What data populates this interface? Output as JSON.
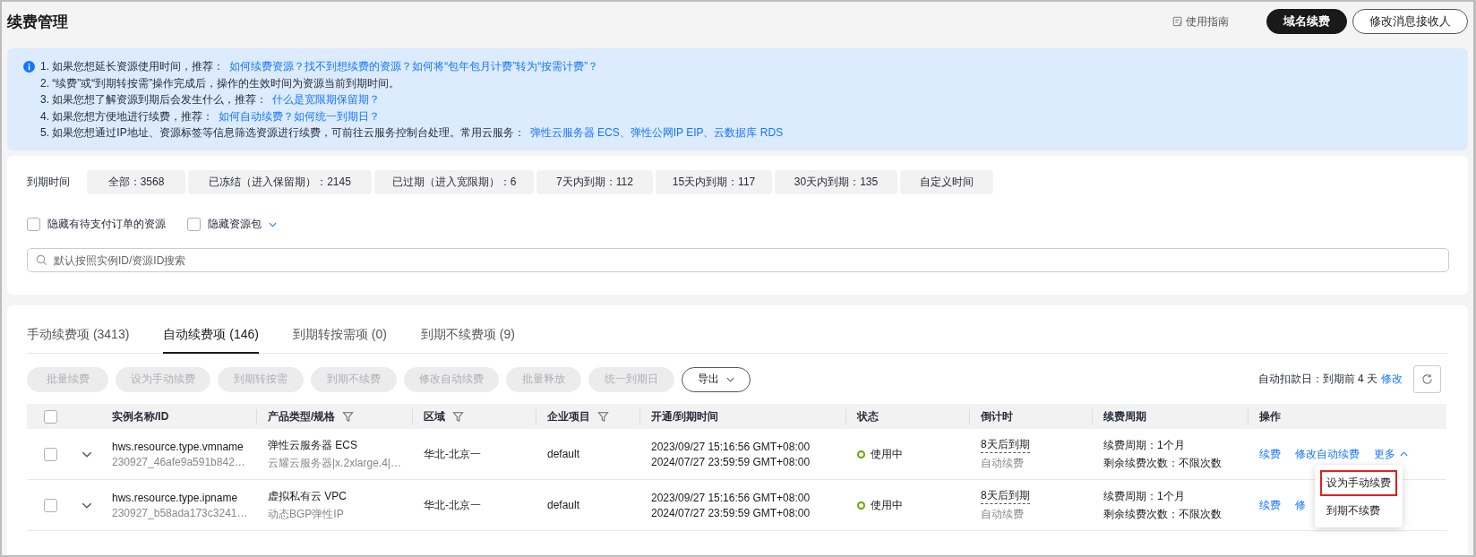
{
  "page_title": "续费管理",
  "header_actions": {
    "guide_link": "使用指南",
    "buttons": [
      {
        "label": "域名续费",
        "kind": "primary"
      },
      {
        "label": "修改消息接收人",
        "kind": "outline"
      }
    ]
  },
  "notice": {
    "lines": [
      {
        "text": "1. 如果您想延长资源使用时间，推荐：",
        "links": [
          "如何续费资源？找不到想续费的资源？如何将“包年包月计费”转为“按需计费”？"
        ]
      },
      {
        "text": "2. “续费”或“到期转按需”操作完成后，操作的生效时间为资源当前到期时间。"
      },
      {
        "text": "3. 如果您想了解资源到期后会发生什么，推荐：",
        "links": [
          "什么是宽限期保留期？"
        ]
      },
      {
        "text": "4. 如果您想方便地进行续费，推荐：",
        "links": [
          "如何自动续费？如何统一到期日？"
        ]
      },
      {
        "text": "5. 如果您想通过IP地址、资源标签等信息筛选资源进行续费，可前往云服务控制台处理。常用云服务：",
        "links": [
          "弹性云服务器 ECS、弹性公网IP EIP、云数据库 RDS"
        ]
      }
    ]
  },
  "filters": {
    "label": "到期时间",
    "chips": [
      "全部：3568",
      "已冻结（进入保留期）：2145",
      "已过期（进入宽限期）：6",
      "7天内到期：112",
      "15天内到期：117",
      "30天内到期：135",
      "自定义时间"
    ],
    "checkboxes": [
      {
        "label": "隐藏有待支付订单的资源",
        "checked": false,
        "kind": "plain"
      },
      {
        "label": "隐藏资源包",
        "checked": false,
        "kind": "dropdown"
      }
    ],
    "search": {
      "placeholder": "默认按照实例ID/资源ID搜索"
    }
  },
  "tabs": [
    {
      "label": "手动续费项 (3413)",
      "selected": false
    },
    {
      "label": "自动续费项 (146)",
      "selected": true
    },
    {
      "label": "到期转按需项 (0)",
      "selected": false
    },
    {
      "label": "到期不续费项 (9)",
      "selected": false
    }
  ],
  "toolbar": {
    "buttons": [
      {
        "label": "批量续费",
        "disabled": true,
        "kind": "plain"
      },
      {
        "label": "设为手动续费",
        "disabled": true,
        "kind": "plain"
      },
      {
        "label": "到期转按需",
        "disabled": true,
        "kind": "plain"
      },
      {
        "label": "到期不续费",
        "disabled": true,
        "kind": "plain"
      },
      {
        "label": "修改自动续费",
        "disabled": true,
        "kind": "plain"
      },
      {
        "label": "批量释放",
        "disabled": true,
        "kind": "plain"
      },
      {
        "label": "统一到期日",
        "disabled": true,
        "kind": "plain"
      },
      {
        "label": "导出",
        "disabled": false,
        "kind": "dropdown"
      }
    ],
    "deduction_text": "自动扣款日：到期前 4 天",
    "deduction_link": "修改"
  },
  "table": {
    "select_all_checked": false,
    "columns": [
      {
        "label": "实例名称/ID",
        "filter": false
      },
      {
        "label": "产品类型/规格",
        "filter": true
      },
      {
        "label": "区域",
        "filter": true
      },
      {
        "label": "企业项目",
        "filter": true
      },
      {
        "label": "开通/到期时间",
        "filter": false
      },
      {
        "label": "状态",
        "filter": false
      },
      {
        "label": "倒计时",
        "filter": false
      },
      {
        "label": "续费周期",
        "filter": false
      },
      {
        "label": "操作",
        "filter": false
      }
    ],
    "rows": [
      {
        "checked": false,
        "name": "hws.resource.type.vmname",
        "id": "230927_46afe9a591b842…",
        "product": "弹性云服务器 ECS",
        "spec": "云耀云服务器|x.2xlarge.4|…",
        "region": "华北-北京一",
        "project": "default",
        "opened": "2023/09/27 15:16:56 GMT+08:00",
        "expires": "2024/07/27 23:59:59 GMT+08:00",
        "status": "使用中",
        "countdown": "8天后到期",
        "renew_mode": "自动续费",
        "cycle": "续费周期：1个月",
        "remaining": "剩余续费次数：不限次数",
        "actions": [
          "续费",
          "修改自动续费"
        ],
        "more": {
          "label": "更多",
          "expanded": true,
          "menu": [
            {
              "label": "设为手动续费",
              "highlighted": true
            },
            {
              "label": "到期不续费",
              "highlighted": false
            }
          ]
        }
      },
      {
        "checked": false,
        "name": "hws.resource.type.ipname",
        "id": "230927_b58ada173c3241…",
        "product": "虚拟私有云 VPC",
        "spec": "动态BGP弹性IP",
        "region": "华北-北京一",
        "project": "default",
        "opened": "2023/09/27 15:16:56 GMT+08:00",
        "expires": "2024/07/27 23:59:59 GMT+08:00",
        "status": "使用中",
        "countdown": "8天后到期",
        "renew_mode": "自动续费",
        "cycle": "续费周期：1个月",
        "remaining": "剩余续费次数：不限次数",
        "actions": [
          "续费",
          "修"
        ]
      }
    ]
  }
}
